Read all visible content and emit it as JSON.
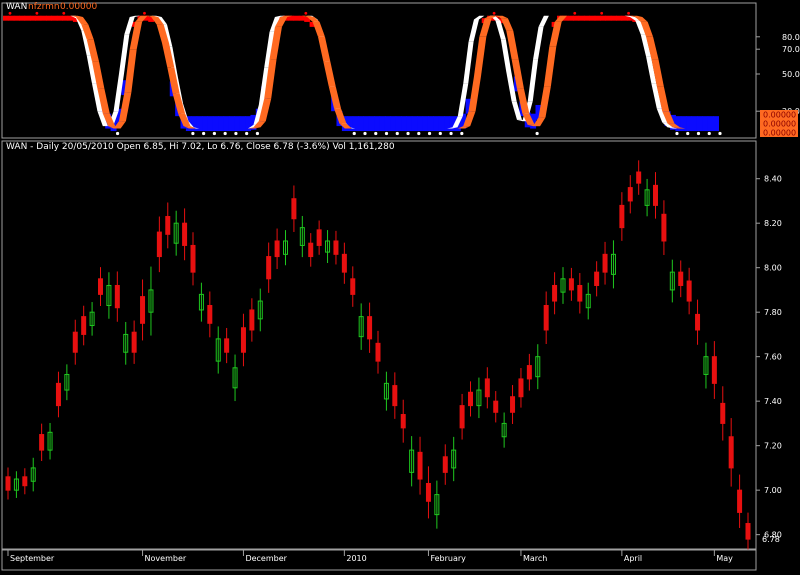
{
  "indicator_header": {
    "symbol": "WAN",
    "name": "nfzrmn",
    "value": "0.00000"
  },
  "indicator_axis": {
    "ticks": [
      {
        "value": 80,
        "label": "80.0"
      },
      {
        "value": 70,
        "label": "70.0"
      },
      {
        "value": 50,
        "label": "50.0"
      },
      {
        "value": 20,
        "label": "20.0"
      }
    ],
    "value_badges": [
      "0.00000",
      "0.00000",
      "0.00000"
    ]
  },
  "price_header": {
    "text": "WAN - Daily 20/05/2010 Open 6.85, Hi 7.02, Lo 6.76, Close 6.78 (-3.6%) Vol 1,161,280"
  },
  "colors": {
    "background": "#000000",
    "frame": "#a0a0a0",
    "up_candle": "#1fc81f",
    "down_candle": "#e81010",
    "indicator_white": "#ffffff",
    "indicator_orange": "#ff6a21",
    "indicator_blue": "#0b0bff",
    "indicator_red": "#ff0000",
    "axis_text": "#ffffff",
    "badge_bg": "#ff6a21",
    "badge_text": "#8b0000"
  },
  "chart_data": [
    {
      "type": "area",
      "title": "nfzrmn",
      "ylim": [
        0,
        100
      ],
      "series": [
        {
          "name": "nfzrmn",
          "values": [
            97,
            97,
            97,
            97,
            97,
            97,
            97,
            97,
            97,
            97,
            97,
            97,
            97,
            96,
            90,
            78,
            60,
            38,
            18,
            8,
            6,
            12,
            35,
            70,
            92,
            97,
            97,
            96,
            90,
            75,
            55,
            34,
            18,
            8,
            6,
            6,
            6,
            6,
            6,
            6,
            6,
            6,
            6,
            6,
            6,
            6,
            7,
            12,
            30,
            62,
            88,
            96,
            97,
            97,
            97,
            97,
            96,
            92,
            80,
            60,
            40,
            22,
            10,
            6,
            6,
            6,
            6,
            6,
            6,
            6,
            6,
            6,
            6,
            6,
            6,
            6,
            6,
            6,
            6,
            6,
            6,
            6,
            6,
            6,
            6,
            8,
            20,
            48,
            80,
            95,
            97,
            97,
            95,
            85,
            62,
            38,
            18,
            9,
            8,
            15,
            40,
            72,
            92,
            97,
            97,
            97,
            97,
            97,
            97,
            97,
            97,
            97,
            97,
            97,
            97,
            97,
            97,
            96,
            92,
            80,
            62,
            40,
            20,
            10,
            7,
            6,
            6,
            6,
            6,
            6,
            6,
            6,
            6
          ]
        },
        {
          "name": "white",
          "values": [
            97,
            97,
            97,
            97,
            97,
            97,
            97,
            97,
            97,
            97,
            97,
            97,
            97,
            95,
            85,
            65,
            42,
            20,
            8,
            8,
            20,
            50,
            82,
            96,
            97,
            97,
            97,
            97,
            96,
            90,
            72,
            48,
            26,
            12,
            7,
            6,
            6,
            6,
            6,
            6,
            6,
            6,
            6,
            6,
            6,
            6,
            9,
            25,
            55,
            84,
            96,
            97,
            97,
            97,
            97,
            97,
            97,
            94,
            84,
            65,
            44,
            25,
            12,
            7,
            6,
            6,
            6,
            6,
            6,
            6,
            6,
            6,
            6,
            6,
            6,
            6,
            6,
            6,
            6,
            6,
            6,
            6,
            6,
            7,
            16,
            42,
            76,
            94,
            97,
            97,
            97,
            93,
            78,
            52,
            28,
            13,
            12,
            28,
            62,
            88,
            97,
            97,
            97,
            97,
            97,
            97,
            97,
            97,
            97,
            97,
            97,
            97,
            97,
            97,
            97,
            97,
            96,
            93,
            82,
            64,
            42,
            22,
            11,
            7,
            6,
            6,
            6,
            6,
            6,
            6,
            6,
            6
          ]
        }
      ]
    },
    {
      "type": "candlestick",
      "title": "WAN - Daily 20/05/2010",
      "ylim": [
        6.74,
        8.52
      ],
      "ticks": [
        8.4,
        8.2,
        8.0,
        7.8,
        7.6,
        7.4,
        7.2,
        7.0,
        6.8
      ],
      "last_close": 6.78,
      "x_labels": [
        {
          "index": 0,
          "label": "September"
        },
        {
          "index": 16,
          "label": "November"
        },
        {
          "index": 28,
          "label": "December"
        },
        {
          "index": 40,
          "label": "2010"
        },
        {
          "index": 50,
          "label": "February"
        },
        {
          "index": 61,
          "label": "March"
        },
        {
          "index": 73,
          "label": "April"
        },
        {
          "index": 84,
          "label": "May"
        }
      ],
      "close": [
        7.0,
        7.05,
        7.02,
        7.1,
        7.18,
        7.26,
        7.38,
        7.52,
        7.62,
        7.7,
        7.8,
        7.88,
        7.92,
        7.82,
        7.7,
        7.62,
        7.75,
        7.9,
        8.05,
        8.15,
        8.2,
        8.1,
        7.98,
        7.88,
        7.75,
        7.68,
        7.62,
        7.55,
        7.62,
        7.72,
        7.85,
        7.95,
        8.05,
        8.12,
        8.22,
        8.18,
        8.05,
        8.1,
        8.12,
        8.06,
        7.98,
        7.88,
        7.78,
        7.68,
        7.58,
        7.48,
        7.38,
        7.28,
        7.18,
        7.05,
        6.95,
        6.98,
        7.08,
        7.18,
        7.28,
        7.38,
        7.45,
        7.42,
        7.35,
        7.3,
        7.35,
        7.42,
        7.5,
        7.6,
        7.72,
        7.85,
        7.95,
        7.9,
        7.85,
        7.88,
        7.92,
        7.98,
        8.06,
        8.18,
        8.3,
        8.38,
        8.35,
        8.28,
        8.12,
        7.98,
        7.92,
        7.85,
        7.72,
        7.6,
        7.48,
        7.3,
        7.1,
        6.9,
        6.78
      ],
      "open_close_delta": [
        0.06,
        -0.05,
        0.04,
        -0.06,
        0.07,
        -0.08,
        0.1,
        -0.07,
        0.09,
        0.08,
        -0.06,
        0.07,
        -0.09,
        0.1,
        -0.08,
        0.09,
        0.12,
        -0.1,
        0.11,
        0.08,
        -0.09,
        0.1,
        0.12,
        -0.07,
        0.08,
        -0.1,
        0.06,
        -0.09,
        0.11,
        0.09,
        -0.08,
        0.1,
        0.07,
        -0.06,
        0.09,
        -0.08,
        0.06,
        0.07,
        -0.05,
        0.06,
        0.08,
        0.07,
        -0.09,
        0.1,
        0.08,
        -0.07,
        0.09,
        0.06,
        -0.1,
        0.12,
        0.08,
        -0.09,
        0.07,
        -0.08,
        0.1,
        0.06,
        -0.07,
        0.08,
        0.05,
        -0.06,
        0.07,
        0.08,
        0.06,
        -0.09,
        0.11,
        0.07,
        -0.06,
        0.05,
        0.07,
        -0.06,
        0.06,
        0.08,
        -0.09,
        0.1,
        0.06,
        0.05,
        -0.07,
        0.09,
        0.12,
        -0.08,
        0.06,
        0.09,
        0.07,
        -0.08,
        0.12,
        0.09,
        0.14,
        0.1,
        0.07
      ],
      "range": [
        0.12,
        0.1,
        0.11,
        0.13,
        0.14,
        0.12,
        0.15,
        0.13,
        0.16,
        0.14,
        0.13,
        0.15,
        0.17,
        0.18,
        0.16,
        0.15,
        0.22,
        0.3,
        0.2,
        0.18,
        0.16,
        0.19,
        0.17,
        0.15,
        0.18,
        0.16,
        0.14,
        0.17,
        0.18,
        0.15,
        0.16,
        0.18,
        0.16,
        0.14,
        0.17,
        0.15,
        0.13,
        0.12,
        0.14,
        0.13,
        0.15,
        0.16,
        0.17,
        0.18,
        0.16,
        0.15,
        0.17,
        0.19,
        0.18,
        0.2,
        0.22,
        0.18,
        0.16,
        0.17,
        0.15,
        0.14,
        0.16,
        0.15,
        0.13,
        0.14,
        0.15,
        0.14,
        0.15,
        0.16,
        0.18,
        0.17,
        0.15,
        0.14,
        0.16,
        0.15,
        0.14,
        0.16,
        0.18,
        0.17,
        0.16,
        0.15,
        0.14,
        0.17,
        0.18,
        0.16,
        0.15,
        0.17,
        0.19,
        0.18,
        0.2,
        0.22,
        0.24,
        0.2,
        0.14
      ]
    }
  ]
}
